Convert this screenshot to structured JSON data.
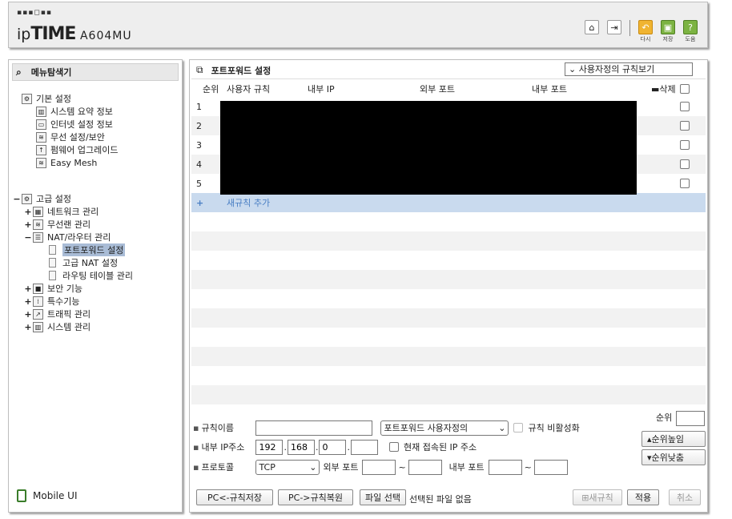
{
  "header": {
    "dots": "▪▪▪◻▪▪",
    "brand_ip": "ip",
    "brand_time": "TIME",
    "model": "A604MU",
    "buttons": [
      {
        "name": "home-icon",
        "glyph": "⌂"
      },
      {
        "name": "logout-icon",
        "glyph": "⇥"
      },
      {
        "name": "redo-icon",
        "glyph": "↶",
        "caption": "다시"
      },
      {
        "name": "save-icon",
        "glyph": "▣",
        "caption": "저장"
      },
      {
        "name": "help-icon",
        "glyph": "?",
        "caption": "도움"
      }
    ]
  },
  "sidebar": {
    "title": "메뉴탐색기",
    "basic": {
      "label": "기본 설정",
      "items": [
        "시스템 요약 정보",
        "인터넷 설정 정보",
        "무선 설정/보안",
        "펌웨어 업그레이드",
        "Easy Mesh"
      ]
    },
    "advanced": {
      "label": "고급 설정",
      "items": [
        "네트워크 관리",
        "무선랜 관리",
        "NAT/라우터 관리",
        "보안 기능",
        "특수기능",
        "트래픽 관리",
        "시스템 관리"
      ],
      "nat_children": [
        "포트포워드 설정",
        "고급 NAT 설정",
        "라우팅 테이블 관리"
      ]
    },
    "mobile_ui": "Mobile UI"
  },
  "main": {
    "title": "포트포워드 설정",
    "view_select": "사용자정의 규칙보기",
    "columns": {
      "order": "순위",
      "rule": "사용자 규칙",
      "internal_ip": "내부 IP",
      "external_port": "외부 포트",
      "internal_port": "내부 포트",
      "delete": "삭제"
    },
    "rows": [
      "1",
      "2",
      "3",
      "4",
      "5"
    ],
    "add_rule": "새규칙 추가"
  },
  "form": {
    "rule_name_label": "규칙이름",
    "rule_name_value": "",
    "rule_type": "포트포워드 사용자정의",
    "disable_rule": "규칙 비활성화",
    "order_label": "순위",
    "order_value": "",
    "move_up": "순위높임",
    "move_down": "순위낮춤",
    "internal_ip_label": "내부 IP주소",
    "ip1": "192",
    "ip2": "168",
    "ip3": "0",
    "ip4": "",
    "current_ip": "현재 접속된 IP 주소",
    "protocol_label": "프로토콜",
    "protocol": "TCP",
    "external_port_label": "외부 포트",
    "internal_port_label": "내부 포트",
    "tilde": "~"
  },
  "footer": {
    "save_pc": "PC<-규칙저장",
    "restore_pc": "PC->규칙복원",
    "file_select": "파일 선택",
    "no_file": "선택된 파일 없음",
    "new_rule": "새규칙",
    "apply": "적용",
    "cancel": "취소"
  }
}
